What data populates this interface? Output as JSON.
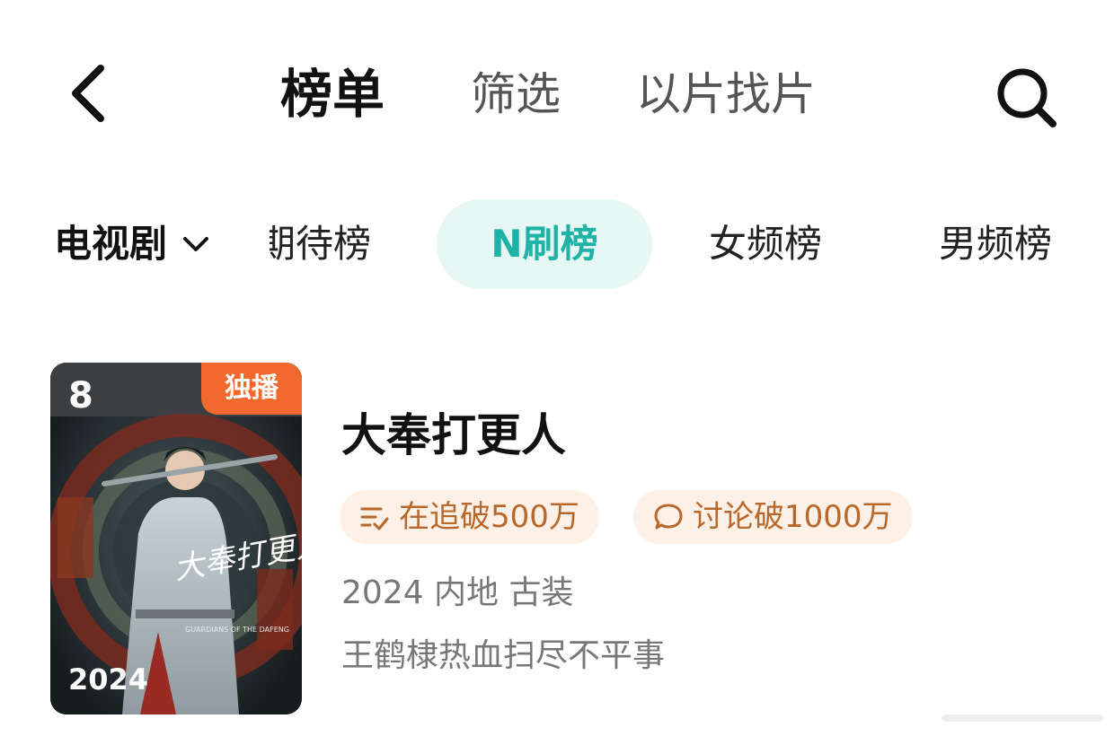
{
  "header": {
    "back_icon": "chevron-left-icon",
    "title": "榜单",
    "tabs": [
      {
        "label": "筛选"
      },
      {
        "label": "以片找片"
      }
    ],
    "search_icon": "search-icon"
  },
  "category": {
    "selected": "电视剧",
    "dropdown_icon": "chevron-down-icon"
  },
  "rank_tabs": [
    {
      "label": "期待榜"
    },
    {
      "label": "N刷榜",
      "active": true
    },
    {
      "label": "女频榜"
    },
    {
      "label": "男频榜"
    }
  ],
  "accent_color": "#1fb2a6",
  "drama": {
    "rank": "8",
    "badge": "独播",
    "poster_year": "2024",
    "poster_calligraphy": "大奉打更人",
    "poster_subtitle": "GUARDIANS OF THE DAFENG",
    "title": "大奉打更人",
    "tags": [
      {
        "icon": "list-check-icon",
        "label": "在追破500万"
      },
      {
        "icon": "chat-bubble-icon",
        "label": "讨论破1000万"
      }
    ],
    "meta": "2024 内地 古装",
    "description": "王鹤棣热血扫尽不平事"
  }
}
